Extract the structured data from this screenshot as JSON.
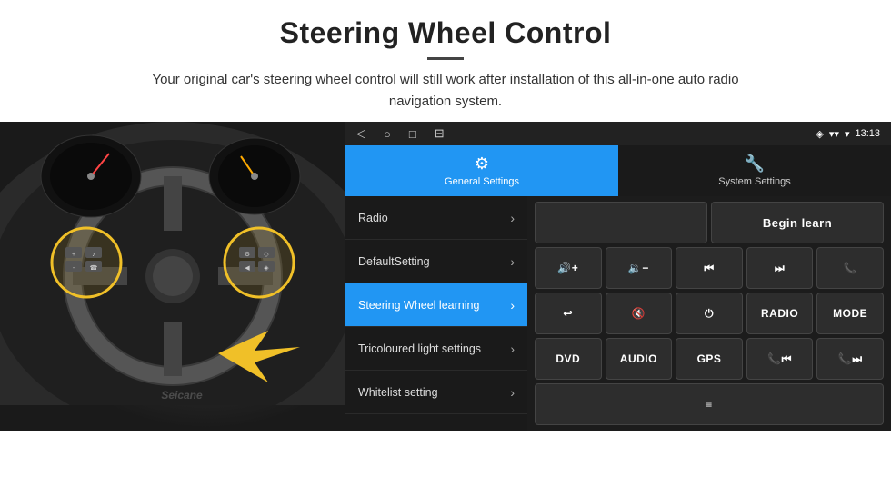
{
  "header": {
    "title": "Steering Wheel Control",
    "subtitle": "Your original car's steering wheel control will still work after installation of this all-in-one auto radio navigation system."
  },
  "android_bar": {
    "nav_back": "◁",
    "nav_home": "○",
    "nav_recent": "□",
    "nav_menu": "⊟",
    "signal": "▾▾",
    "wifi": "▾",
    "time": "13:13"
  },
  "tabs": [
    {
      "id": "general",
      "label": "General Settings",
      "active": true
    },
    {
      "id": "system",
      "label": "System Settings",
      "active": false
    }
  ],
  "menu_items": [
    {
      "id": "radio",
      "label": "Radio",
      "active": false
    },
    {
      "id": "default",
      "label": "DefaultSetting",
      "active": false
    },
    {
      "id": "steering",
      "label": "Steering Wheel learning",
      "active": true
    },
    {
      "id": "tricoloured",
      "label": "Tricoloured light settings",
      "active": false
    },
    {
      "id": "whitelist",
      "label": "Whitelist setting",
      "active": false
    }
  ],
  "controls": {
    "begin_learn_label": "Begin learn",
    "row1": [
      {
        "icon": "🔊+",
        "label": "vol up"
      },
      {
        "icon": "🔉-",
        "label": "vol down"
      },
      {
        "icon": "⏮",
        "label": "prev"
      },
      {
        "icon": "⏭",
        "label": "next"
      },
      {
        "icon": "📞",
        "label": "call"
      }
    ],
    "row2": [
      {
        "icon": "↩",
        "label": "back"
      },
      {
        "icon": "🔇",
        "label": "mute"
      },
      {
        "icon": "⏻",
        "label": "power"
      },
      {
        "icon": "RADIO",
        "label": "radio"
      },
      {
        "icon": "MODE",
        "label": "mode"
      }
    ],
    "row3": [
      {
        "icon": "DVD",
        "label": "dvd"
      },
      {
        "icon": "AUDIO",
        "label": "audio"
      },
      {
        "icon": "GPS",
        "label": "gps"
      },
      {
        "icon": "📞⏮",
        "label": "call prev"
      },
      {
        "icon": "📞⏭",
        "label": "call next"
      }
    ],
    "row4": [
      {
        "icon": "≡",
        "label": "menu"
      }
    ]
  },
  "watermark": "Seicane"
}
